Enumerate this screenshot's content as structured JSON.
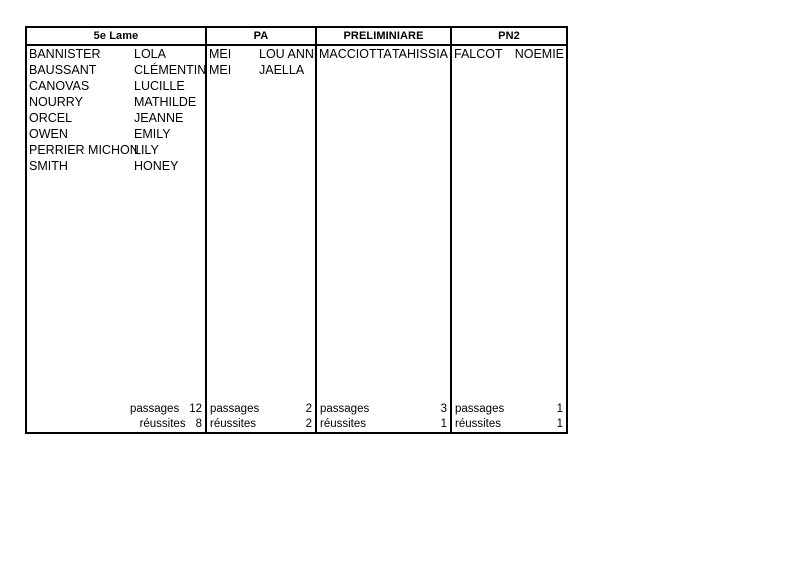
{
  "document": {
    "background_color": "#ffffff",
    "text_color": "#000000",
    "border_color": "#000000"
  },
  "table": {
    "columns": [
      {
        "key": "col_5e_lame",
        "header": "5e Lame",
        "entries": [
          {
            "last_name": "BANNISTER",
            "first_name": "LOLA"
          },
          {
            "last_name": "BAUSSANT",
            "first_name": "CLÉMENTINE"
          },
          {
            "last_name": "CANOVAS",
            "first_name": "LUCILLE"
          },
          {
            "last_name": "NOURRY",
            "first_name": "MATHILDE"
          },
          {
            "last_name": "ORCEL",
            "first_name": "JEANNE"
          },
          {
            "last_name": "OWEN",
            "first_name": "EMILY"
          },
          {
            "last_name": "PERRIER MICHON",
            "first_name": "LILY"
          },
          {
            "last_name": "SMITH",
            "first_name": "HONEY"
          }
        ],
        "tally": {
          "passages_label": "passages",
          "passages_value": "12",
          "reussites_label": "réussites",
          "reussites_value": "8"
        }
      },
      {
        "key": "col_pa",
        "header": "PA",
        "entries": [
          {
            "last_name": "MEI",
            "first_name": "LOU ANNE"
          },
          {
            "last_name": "MEI",
            "first_name": "JAELLA"
          }
        ],
        "tally": {
          "passages_label": "passages",
          "passages_value": "2",
          "reussites_label": "réussites",
          "reussites_value": "2"
        }
      },
      {
        "key": "col_preliminiare",
        "header": "PRELIMINIARE",
        "entries": [
          {
            "last_name": "MACCIOTTA",
            "first_name": "TAHISSIA"
          }
        ],
        "tally": {
          "passages_label": "passages",
          "passages_value": "3",
          "reussites_label": "réussites",
          "reussites_value": "1"
        }
      },
      {
        "key": "col_pn2",
        "header": "PN2",
        "entries": [
          {
            "last_name": "FALCOT",
            "first_name": "NOEMIE"
          }
        ],
        "tally": {
          "passages_label": "passages",
          "passages_value": "1",
          "reussites_label": "réussites",
          "reussites_value": "1"
        }
      }
    ]
  }
}
